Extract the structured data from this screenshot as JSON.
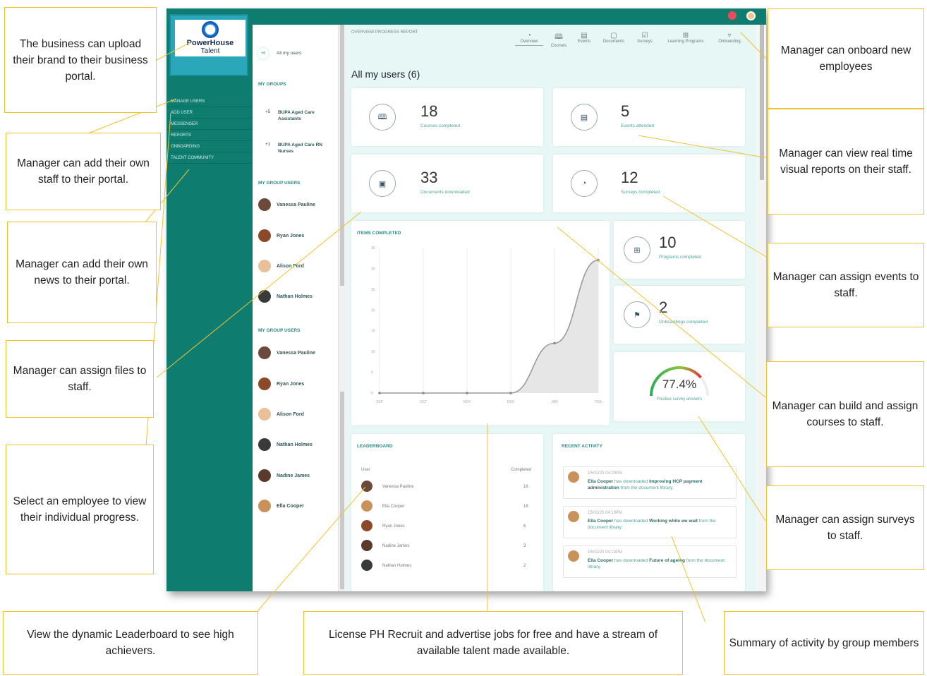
{
  "callouts": {
    "brand": "The business can upload their brand to their business portal.",
    "add_staff": "Manager can add their own staff to their portal.",
    "add_news": "Manager can add their own news to their portal.",
    "assign_files": "Manager can assign files to staff.",
    "select_employee": "Select an employee to view their individual progress.",
    "leaderboard": "View the dynamic Leaderboard to see high achievers.",
    "license": "License PH Recruit and advertise jobs for free and have a stream of available talent made available.",
    "summary": "Summary of activity by group members",
    "onboard": "Manager can onboard new employees",
    "reports": "Manager can view real time visual reports on their staff.",
    "events": "Manager can assign events to staff.",
    "courses": "Manager can build and assign courses to staff.",
    "surveys": "Manager can assign surveys to staff."
  },
  "logo": {
    "line1": "PowerHouse",
    "line2": "Talent"
  },
  "nav": [
    "MANAGE USERS",
    "ADD USER",
    "MESSENGER",
    "REPORTS",
    "ONBOARDING",
    "TALENT COMMUNITY"
  ],
  "groups_panel": {
    "all_count": "+6",
    "all_label": "All my users",
    "my_groups": "MY GROUPS",
    "groups": [
      {
        "count": "+5",
        "name": "BUPA Aged Care Assistants"
      },
      {
        "count": "+1",
        "name": "BUPA Aged Care RN Nurses"
      }
    ],
    "group_users_title_1": "MY GROUP USERS",
    "users_1": [
      "Vanessa Pauline",
      "Ryan Jones",
      "Alison Ford",
      "Nathan Holmes"
    ],
    "group_users_title_2": "MY GROUP USERS",
    "users_2": [
      "Vanessa Pauline",
      "Ryan Jones",
      "Alison Ford",
      "Nathan Holmes",
      "Nadine James",
      "Ella Cooper"
    ]
  },
  "header": {
    "title": "OVERVIEW PROGRESS REPORT",
    "tabs": [
      "Overview",
      "Courses",
      "Events",
      "Documents",
      "Surveys",
      "Learning Programs",
      "Onboarding"
    ]
  },
  "main": {
    "heading": "All my users (6)",
    "stats": [
      {
        "value": "18",
        "label": "Courses completed"
      },
      {
        "value": "5",
        "label": "Events attended"
      },
      {
        "value": "33",
        "label": "Documents downloaded"
      },
      {
        "value": "12",
        "label": "Surveys completed"
      },
      {
        "value": "10",
        "label": "Programs completed"
      },
      {
        "value": "2",
        "label": "Onboardings completed"
      }
    ],
    "gauge": {
      "value": "77.4%",
      "label": "Positive survey answers",
      "fraction": 0.774
    },
    "items_completed_title": "ITEMS COMPLETED"
  },
  "chart_data": {
    "type": "area",
    "categories": [
      "SEP",
      "OCT",
      "NOV",
      "DEC",
      "JAN",
      "FEB"
    ],
    "values": [
      0,
      0,
      0,
      0,
      12,
      32
    ],
    "ylim": [
      0,
      35
    ],
    "yticks": [
      "35",
      "30",
      "25",
      "20",
      "15",
      "10",
      "5",
      "0"
    ]
  },
  "leaderboard": {
    "title": "LEADERBOARD",
    "col_user": "User",
    "col_completed": "Completed",
    "rows": [
      {
        "name": "Vanessa Pauline",
        "value": "18"
      },
      {
        "name": "Ella Cooper",
        "value": "18"
      },
      {
        "name": "Ryan Jones",
        "value": "6"
      },
      {
        "name": "Nadine James",
        "value": "3"
      },
      {
        "name": "Nathan Holmes",
        "value": "2"
      }
    ]
  },
  "activity": {
    "title": "RECENT ACTIVITY",
    "items": [
      {
        "time": "15/02/20 04:29PM",
        "user": "Ella Cooper",
        "verb": "has downloaded",
        "doc": "Improving HCP payment administration",
        "tail": "from the document library."
      },
      {
        "time": "15/02/20 04:19PM",
        "user": "Ella Cooper",
        "verb": "has downloaded",
        "doc": "Working while we wait",
        "tail": "from the document library."
      },
      {
        "time": "15/02/20 04:13PM",
        "user": "Ella Cooper",
        "verb": "has downloaded",
        "doc": "Future of ageing",
        "tail": "from the document library."
      }
    ]
  },
  "colors": {
    "teal": "#0f7c70",
    "accent": "#f2c22c"
  }
}
